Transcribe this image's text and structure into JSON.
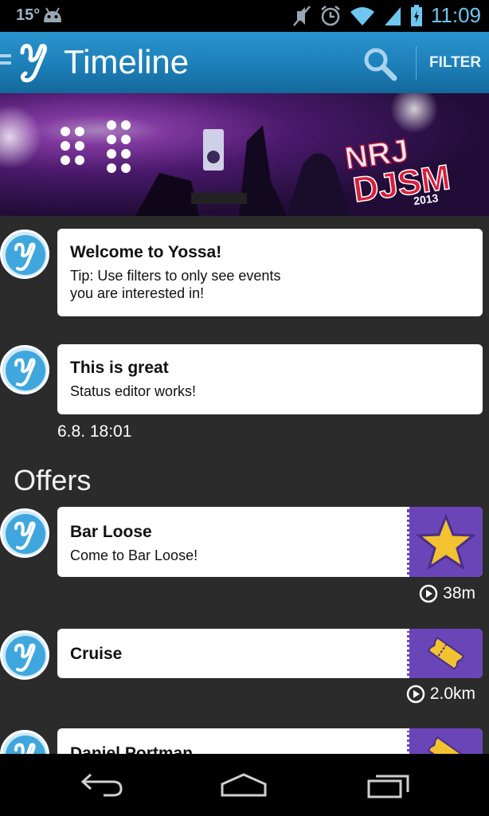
{
  "status_bar": {
    "temperature": "15°",
    "time": "11:09",
    "icons": [
      "android-icon",
      "mute-icon",
      "alarm-icon",
      "wifi-icon",
      "signal-icon",
      "battery-icon"
    ]
  },
  "action_bar": {
    "title": "Timeline",
    "filter_label": "FILTER",
    "icons": [
      "menu-icon",
      "yossa-logo",
      "search-icon"
    ]
  },
  "banner": {
    "logo_text_top": "NRJ",
    "logo_text_mid": "DJSM",
    "logo_text_year": "2013"
  },
  "timeline": [
    {
      "title": "Welcome to Yossa!",
      "text": "Tip: Use filters to only see events\nyou are interested in!",
      "timestamp": ""
    },
    {
      "title": "This is great",
      "text": "Status editor works!",
      "timestamp": "6.8. 18:01"
    }
  ],
  "offers_section": {
    "title": "Offers",
    "items": [
      {
        "title": "Bar Loose",
        "text": "Come to Bar Loose!",
        "distance": "38m",
        "icon": "star-icon"
      },
      {
        "title": "Cruise",
        "text": "",
        "distance": "2.0km",
        "icon": "ticket-icon"
      },
      {
        "title": "Daniel Portman",
        "text": "",
        "distance": "",
        "icon": "ticket-icon"
      }
    ]
  },
  "colors": {
    "action_bar": "#1d7fb8",
    "background": "#2b2b2b",
    "offer_thumb": "#6a45b8",
    "star": "#f2c230"
  },
  "nav_bar": {
    "icons": [
      "back-icon",
      "home-icon",
      "recent-apps-icon"
    ]
  }
}
